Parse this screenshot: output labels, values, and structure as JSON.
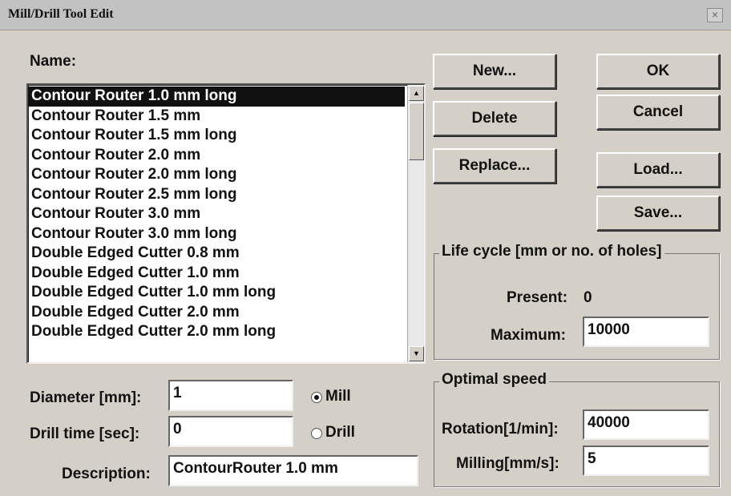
{
  "window": {
    "title": "Mill/Drill Tool Edit",
    "close_glyph": "×"
  },
  "name_label": "Name:",
  "tool_list": [
    "Contour Router 1.0 mm long",
    "Contour Router 1.5 mm",
    "Contour Router 1.5 mm long",
    "Contour Router 2.0 mm",
    "Contour Router 2.0 mm long",
    "Contour Router 2.5 mm long",
    "Contour Router 3.0 mm",
    "Contour Router 3.0 mm long",
    "Double Edged Cutter 0.8 mm",
    "Double Edged Cutter 1.0 mm",
    "Double Edged Cutter 1.0 mm long",
    "Double Edged Cutter 2.0 mm",
    "Double Edged Cutter 2.0 mm long"
  ],
  "selected_index": 0,
  "scroll_up_glyph": "▲",
  "scroll_down_glyph": "▼",
  "buttons": {
    "new": "New...",
    "delete": "Delete",
    "replace": "Replace...",
    "ok": "OK",
    "cancel": "Cancel",
    "load": "Load...",
    "save": "Save..."
  },
  "life_cycle": {
    "title": "Life cycle [mm or no. of holes]",
    "present_label": "Present:",
    "present_value": "0",
    "maximum_label": "Maximum:",
    "maximum_value": "10000"
  },
  "params": {
    "diameter_label": "Diameter [mm]:",
    "diameter_value": "1",
    "drill_time_label": "Drill time [sec]:",
    "drill_time_value": "0",
    "description_label": "Description:",
    "description_value": "ContourRouter 1.0 mm"
  },
  "mode": {
    "mill_label": "Mill",
    "drill_label": "Drill",
    "selected": "Mill"
  },
  "optimal_speed": {
    "title": "Optimal speed",
    "rotation_label": "Rotation[1/min]:",
    "rotation_value": "40000",
    "milling_label": "Milling[mm/s]:",
    "milling_value": "5"
  }
}
